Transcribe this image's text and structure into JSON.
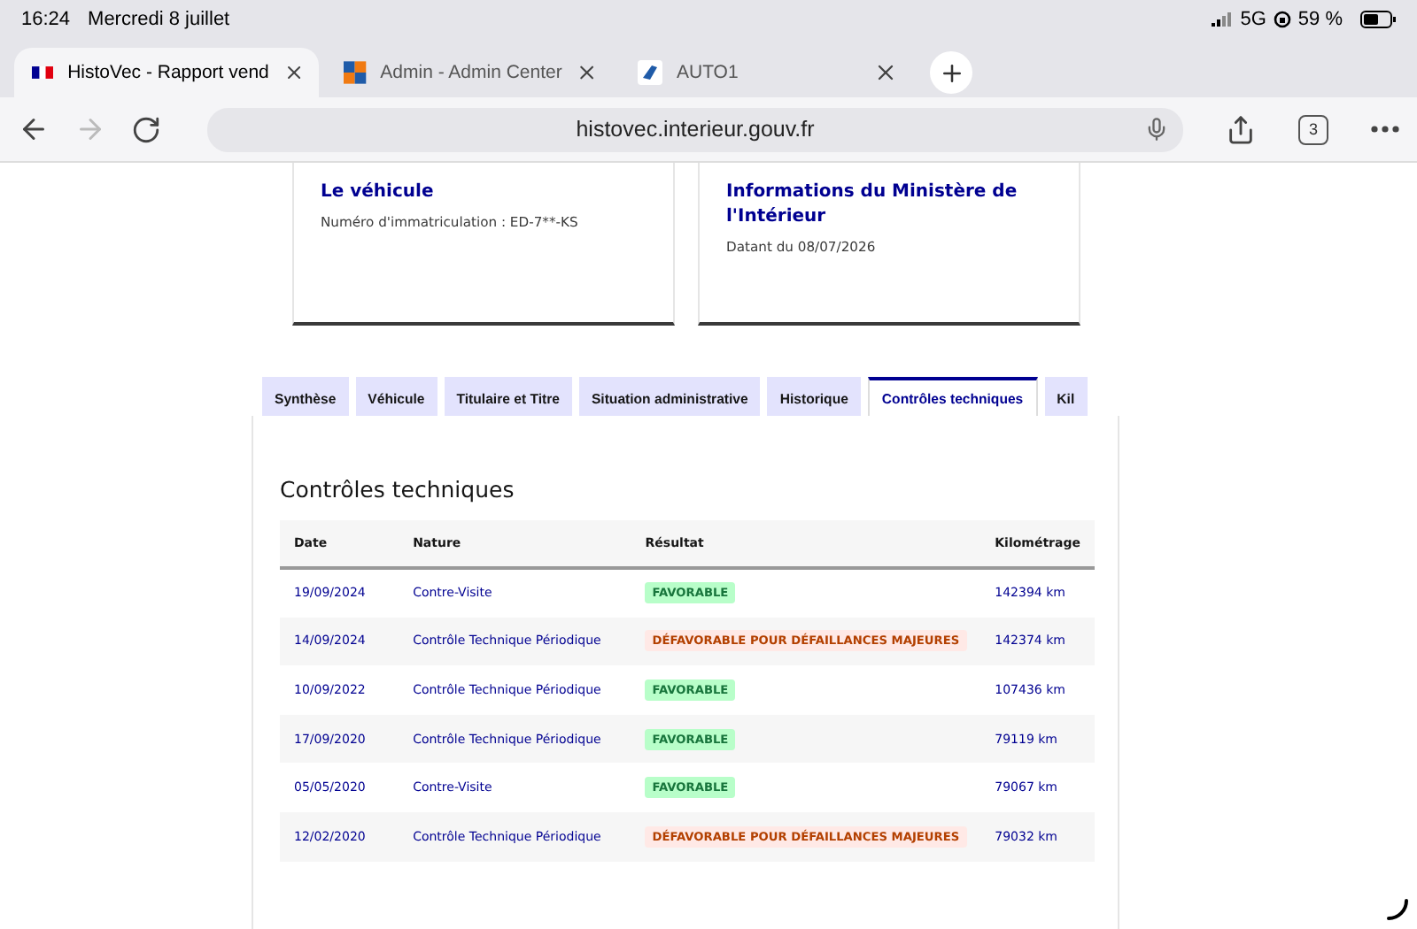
{
  "status_bar": {
    "time": "16:24",
    "date": "Mercredi 8 juillet",
    "network": "5G",
    "battery": "59 %"
  },
  "browser_tabs": [
    {
      "title": "HistoVec - Rapport vend",
      "selected": true
    },
    {
      "title": "Admin - Admin Center",
      "selected": false
    },
    {
      "title": "AUTO1",
      "selected": false
    }
  ],
  "toolbar": {
    "back_disabled": false,
    "forward_disabled": true,
    "url": "histovec.interieur.gouv.fr",
    "tab_count": "3"
  },
  "cards": [
    {
      "title": "Le véhicule",
      "subtitle": "Numéro d'immatriculation : ED-7**-KS"
    },
    {
      "title": "Informations du Ministère de l'Intérieur",
      "subtitle": "Datant du 08/07/2026"
    }
  ],
  "tabs": [
    {
      "label": "Synthèse",
      "selected": false
    },
    {
      "label": "Véhicule",
      "selected": false
    },
    {
      "label": "Titulaire et Titre",
      "selected": false
    },
    {
      "label": "Situation administrative",
      "selected": false
    },
    {
      "label": "Historique",
      "selected": false
    },
    {
      "label": "Contrôles techniques",
      "selected": true
    },
    {
      "label": "Kil",
      "selected": false
    }
  ],
  "section": {
    "title": "Contrôles techniques",
    "columns": [
      "Date",
      "Nature",
      "Résultat",
      "Kilométrage"
    ],
    "rows": [
      {
        "date": "19/09/2024",
        "nature": "Contre-Visite",
        "result": "FAVORABLE",
        "kind": "favorable",
        "km": "142394 km"
      },
      {
        "date": "14/09/2024",
        "nature": "Contrôle Technique Périodique",
        "result": "DÉFAVORABLE POUR DÉFAILLANCES MAJEURES",
        "kind": "unfavorable",
        "km": "142374 km"
      },
      {
        "date": "10/09/2022",
        "nature": "Contrôle Technique Périodique",
        "result": "FAVORABLE",
        "kind": "favorable",
        "km": "107436 km"
      },
      {
        "date": "17/09/2020",
        "nature": "Contrôle Technique Périodique",
        "result": "FAVORABLE",
        "kind": "favorable",
        "km": "79119 km"
      },
      {
        "date": "05/05/2020",
        "nature": "Contre-Visite",
        "result": "FAVORABLE",
        "kind": "favorable",
        "km": "79067 km"
      },
      {
        "date": "12/02/2020",
        "nature": "Contrôle Technique Périodique",
        "result": "DÉFAVORABLE POUR DÉFAILLANCES MAJEURES",
        "kind": "unfavorable",
        "km": "79032 km"
      }
    ]
  }
}
